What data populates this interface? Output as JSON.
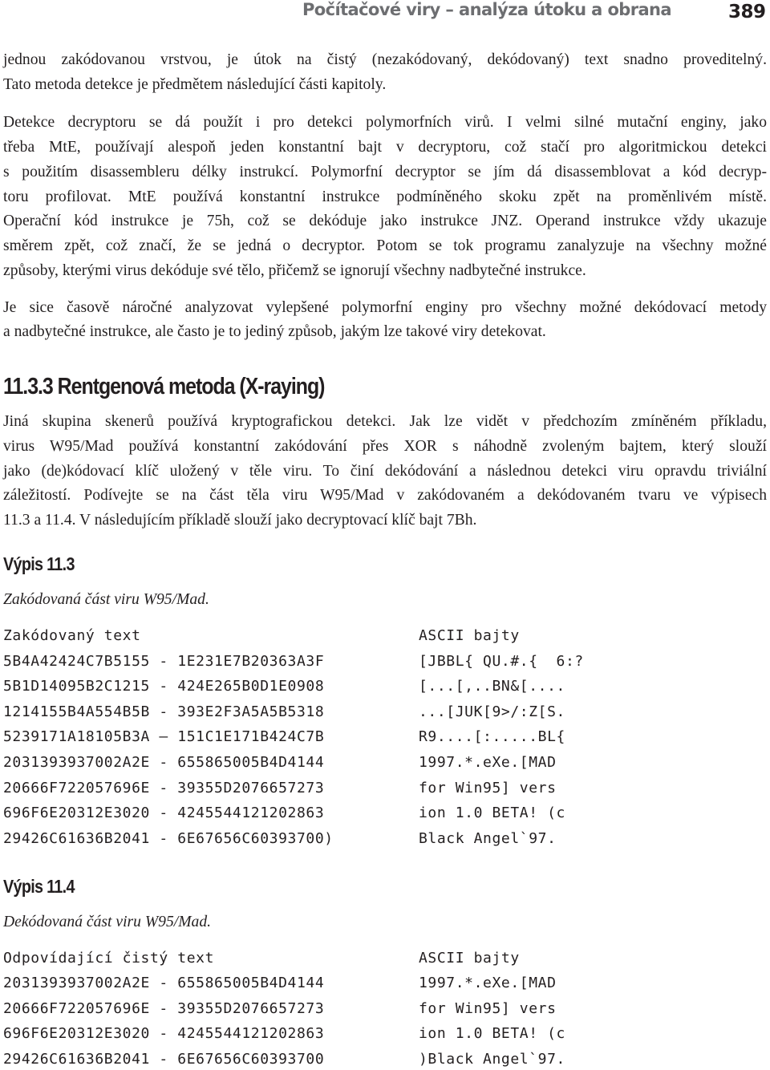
{
  "header": {
    "title": "Počítačové viry – analýza útoku a obrana",
    "page_number": "389"
  },
  "paragraphs": [
    {
      "lines": [
        "jednou zakódovanou vrstvou, je útok na čistý (nezakódovaný, dekódovaný) text snadno proveditelný.",
        "Tato metoda detekce je předmětem následující části kapitoly."
      ]
    },
    {
      "lines": [
        "Detekce decryptoru se dá použít i pro detekci polymorfních virů. I velmi silné mutační enginy, jako",
        "třeba MtE, používají alespoň jeden konstantní bajt v decryptoru, což stačí pro algoritmickou detekci",
        "s použitím disassembleru délky instrukcí. Polymorfní decryptor se jím dá disassemblovat a kód decryp-",
        "toru profilovat. MtE používá konstantní instrukce podmíněného skoku zpět na proměnlivém místě.",
        "Operační kód instrukce je 75h, což se dekóduje jako instrukce JNZ. Operand instrukce vždy ukazuje",
        "směrem zpět, což značí, že se jedná o decryptor. Potom se tok programu zanalyzuje na všechny možné",
        "způsoby, kterými virus dekóduje své tělo, přičemž se ignorují všechny nadbytečné instrukce."
      ]
    },
    {
      "lines": [
        "Je sice časově náročné analyzovat vylepšené polymorfní enginy pro všechny možné dekódovací metody",
        "a nadbytečné instrukce, ale často je to jediný způsob, jakým lze takové viry detekovat."
      ]
    }
  ],
  "section": {
    "heading": "11.3.3 Rentgenová metoda (X-raying)",
    "lines": [
      "Jiná skupina skenerů používá kryptografickou detekci. Jak lze vidět v předchozím zmíněném příkladu,",
      "virus W95/Mad používá konstantní zakódování přes XOR s náhodně zvoleným bajtem, který slouží",
      "jako (de)kódovací klíč uložený v těle viru. To činí dekódování a následnou detekci viru opravdu triviální",
      "záležitostí. Podívejte se na část těla viru W95/Mad v zakódovaném a dekódovaném tvaru ve výpisech",
      "11.3 a 11.4. V následujícím příkladě slouží jako decryptovací klíč bajt 7Bh."
    ]
  },
  "listings": [
    {
      "title": "Výpis 11.3",
      "caption": "Zakódovaná část viru W95/Mad.",
      "col_headers": [
        "Zakódovaný text",
        "ASCII bajty"
      ],
      "rows": [
        {
          "hex": "5B4A42424C7B5155 - 1E231E7B20363A3F",
          "ascii": "[JBBL{ QU.#.{  6:?"
        },
        {
          "hex": "5B1D14095B2C1215 - 424E265B0D1E0908",
          "ascii": "[...[,..BN&[...."
        },
        {
          "hex": "1214155B4A554B5B - 393E2F3A5A5B5318",
          "ascii": "...[JUK[9>/:Z[S."
        },
        {
          "hex": "5239171A18105B3A – 151C1E171B424C7B",
          "ascii": "R9....[:.....BL{"
        },
        {
          "hex": "2031393937002A2E - 655865005B4D4144",
          "ascii": "1997.*.eXe.[MAD"
        },
        {
          "hex": "20666F722057696E - 39355D2076657273",
          "ascii": "for Win95] vers"
        },
        {
          "hex": "696F6E20312E3020 - 4245544121202863",
          "ascii": "ion 1.0 BETA! (c"
        },
        {
          "hex": "29426C61636B2041 - 6E67656C60393700)",
          "ascii": "Black Angel`97."
        }
      ]
    },
    {
      "title": "Výpis 11.4",
      "caption": "Dekódovaná část viru W95/Mad.",
      "col_headers": [
        "Odpovídající čistý text",
        "ASCII bajty"
      ],
      "rows": [
        {
          "hex": "2031393937002A2E - 655865005B4D4144",
          "ascii": "1997.*.eXe.[MAD"
        },
        {
          "hex": "20666F722057696E - 39355D2076657273",
          "ascii": "for Win95] vers"
        },
        {
          "hex": "696F6E20312E3020 - 4245544121202863",
          "ascii": "ion 1.0 BETA! (c"
        },
        {
          "hex": "29426C61636B2041 - 6E67656C60393700",
          "ascii": ")Black Angel`97."
        }
      ]
    }
  ]
}
